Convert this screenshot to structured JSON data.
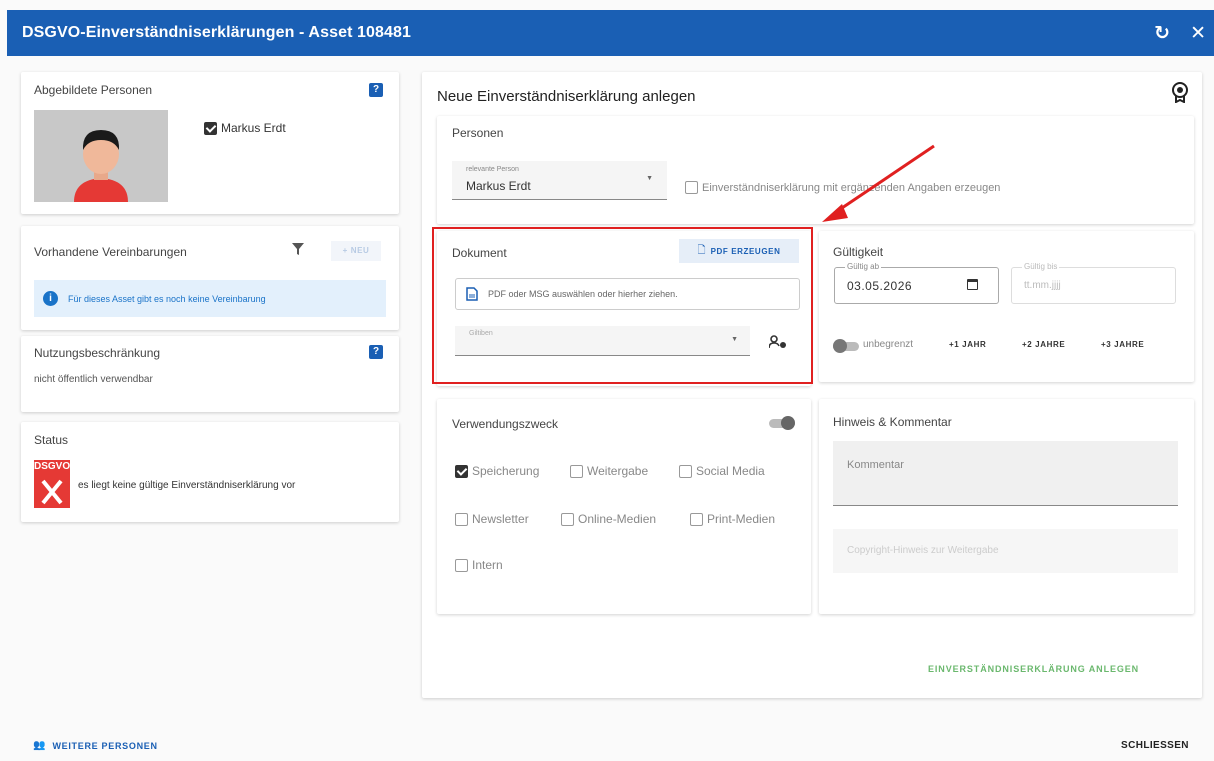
{
  "window": {
    "title": "DSGVO-Einverständniserklärungen - Asset 108481",
    "refresh_icon": "refresh-icon",
    "close_icon": "close-icon"
  },
  "left": {
    "persons": {
      "title": "Abgebildete Personen",
      "help": "?",
      "person_name": "Markus Erdt"
    },
    "agreements": {
      "title": "Vorhandene Vereinbarungen",
      "new_label": "+ NEU",
      "info": "Für dieses Asset gibt es noch keine Vereinbarung",
      "info_color": "#1a73c8"
    },
    "restriction": {
      "title": "Nutzungsbeschränkung",
      "help": "?",
      "value": "nicht öffentlich verwendbar"
    },
    "status": {
      "title": "Status",
      "badge_text": "DSGVO",
      "badge_color": "#e53935",
      "text": "es liegt keine gültige Einverständniserklärung vor"
    }
  },
  "main": {
    "title": "Neue Einverständniserklärung anlegen",
    "persons_section": {
      "title": "Personen",
      "select_label": "relevante Person",
      "select_value": "Markus Erdt",
      "extended_label": "Einverständniserklärung mit ergänzenden Angaben erzeugen"
    },
    "document": {
      "title": "Dokument",
      "pdf_button": "PDF ERZEUGEN",
      "upload_text": "PDF oder MSG auswählen oder hierher ziehen.",
      "signer_label": "Giltiben"
    },
    "validity": {
      "title": "Gültigkeit",
      "from_label": "Gültig ab",
      "from_value": "03.05.2026",
      "to_label": "Gültig bis",
      "to_placeholder": "tt.mm.jjjj",
      "unlimited_label": "unbegrenzt",
      "plus1": "+1 JAHR",
      "plus2": "+2 JAHRE",
      "plus3": "+3 JAHRE"
    },
    "purpose": {
      "title": "Verwendungszweck",
      "options": [
        "Speicherung",
        "Weitergabe",
        "Social Media",
        "Newsletter",
        "Online-Medien",
        "Print-Medien",
        "Intern"
      ],
      "checked": "Speicherung"
    },
    "notes": {
      "title": "Hinweis & Kommentar",
      "comment_placeholder": "Kommentar",
      "copyright_placeholder": "Copyright-Hinweis zur Weitergabe"
    },
    "create_button": "EINVERSTÄNDNISERKLÄRUNG ANLEGEN",
    "create_color": "#43a047"
  },
  "footer": {
    "more_persons": "WEITERE PERSONEN",
    "close": "SCHLIESSEN"
  },
  "colors": {
    "primary": "#1a5fb4",
    "highlight": "#e02020"
  }
}
